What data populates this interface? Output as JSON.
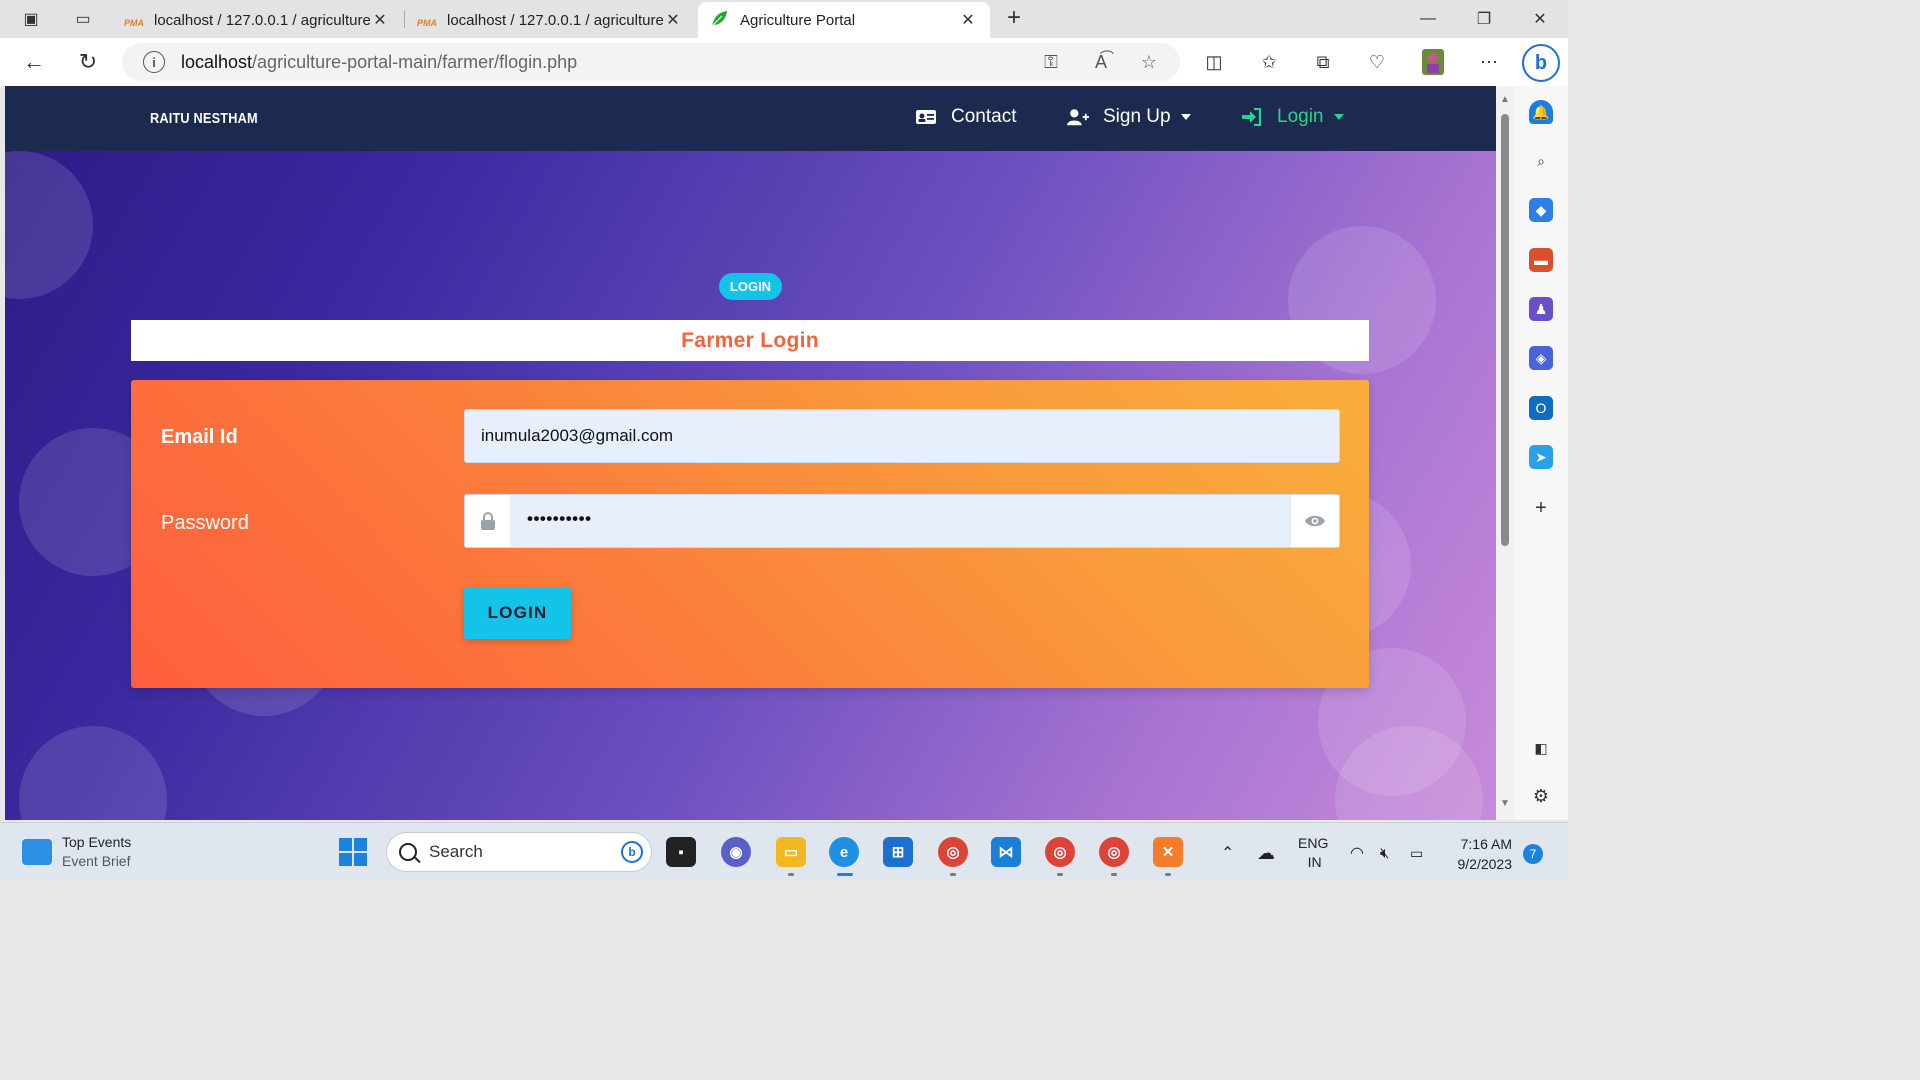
{
  "browser": {
    "tabs": [
      {
        "title": "localhost / 127.0.0.1 / agriculture",
        "favicon": "PMA"
      },
      {
        "title": "localhost / 127.0.0.1 / agriculture",
        "favicon": "PMA"
      },
      {
        "title": "Agriculture Portal",
        "favicon": "leaf-icon"
      }
    ],
    "url_host": "localhost",
    "url_path": "/agriculture-portal-main/farmer/flogin.php"
  },
  "site": {
    "brand": "RAITU NESTHAM",
    "nav": {
      "contact": "Contact",
      "signup": "Sign Up",
      "login": "Login"
    },
    "login_badge": "LOGIN",
    "card_title": "Farmer Login",
    "form": {
      "email_label": "Email Id",
      "email_value": "inumula2003@gmail.com",
      "password_label": "Password",
      "password_value": "••••••••••",
      "submit_label": "LOGIN"
    }
  },
  "taskbar": {
    "widget_title": "Top Events",
    "widget_sub": "Event Brief",
    "search_placeholder": "Search",
    "lang_top": "ENG",
    "lang_bottom": "IN",
    "time": "7:16 AM",
    "date": "9/2/2023",
    "notifications": "7"
  },
  "colors": {
    "navbar": "#1b2a4e",
    "accent_cyan": "#13c3e8",
    "login_green": "#2fd08a",
    "title_orange": "#f2653c"
  }
}
